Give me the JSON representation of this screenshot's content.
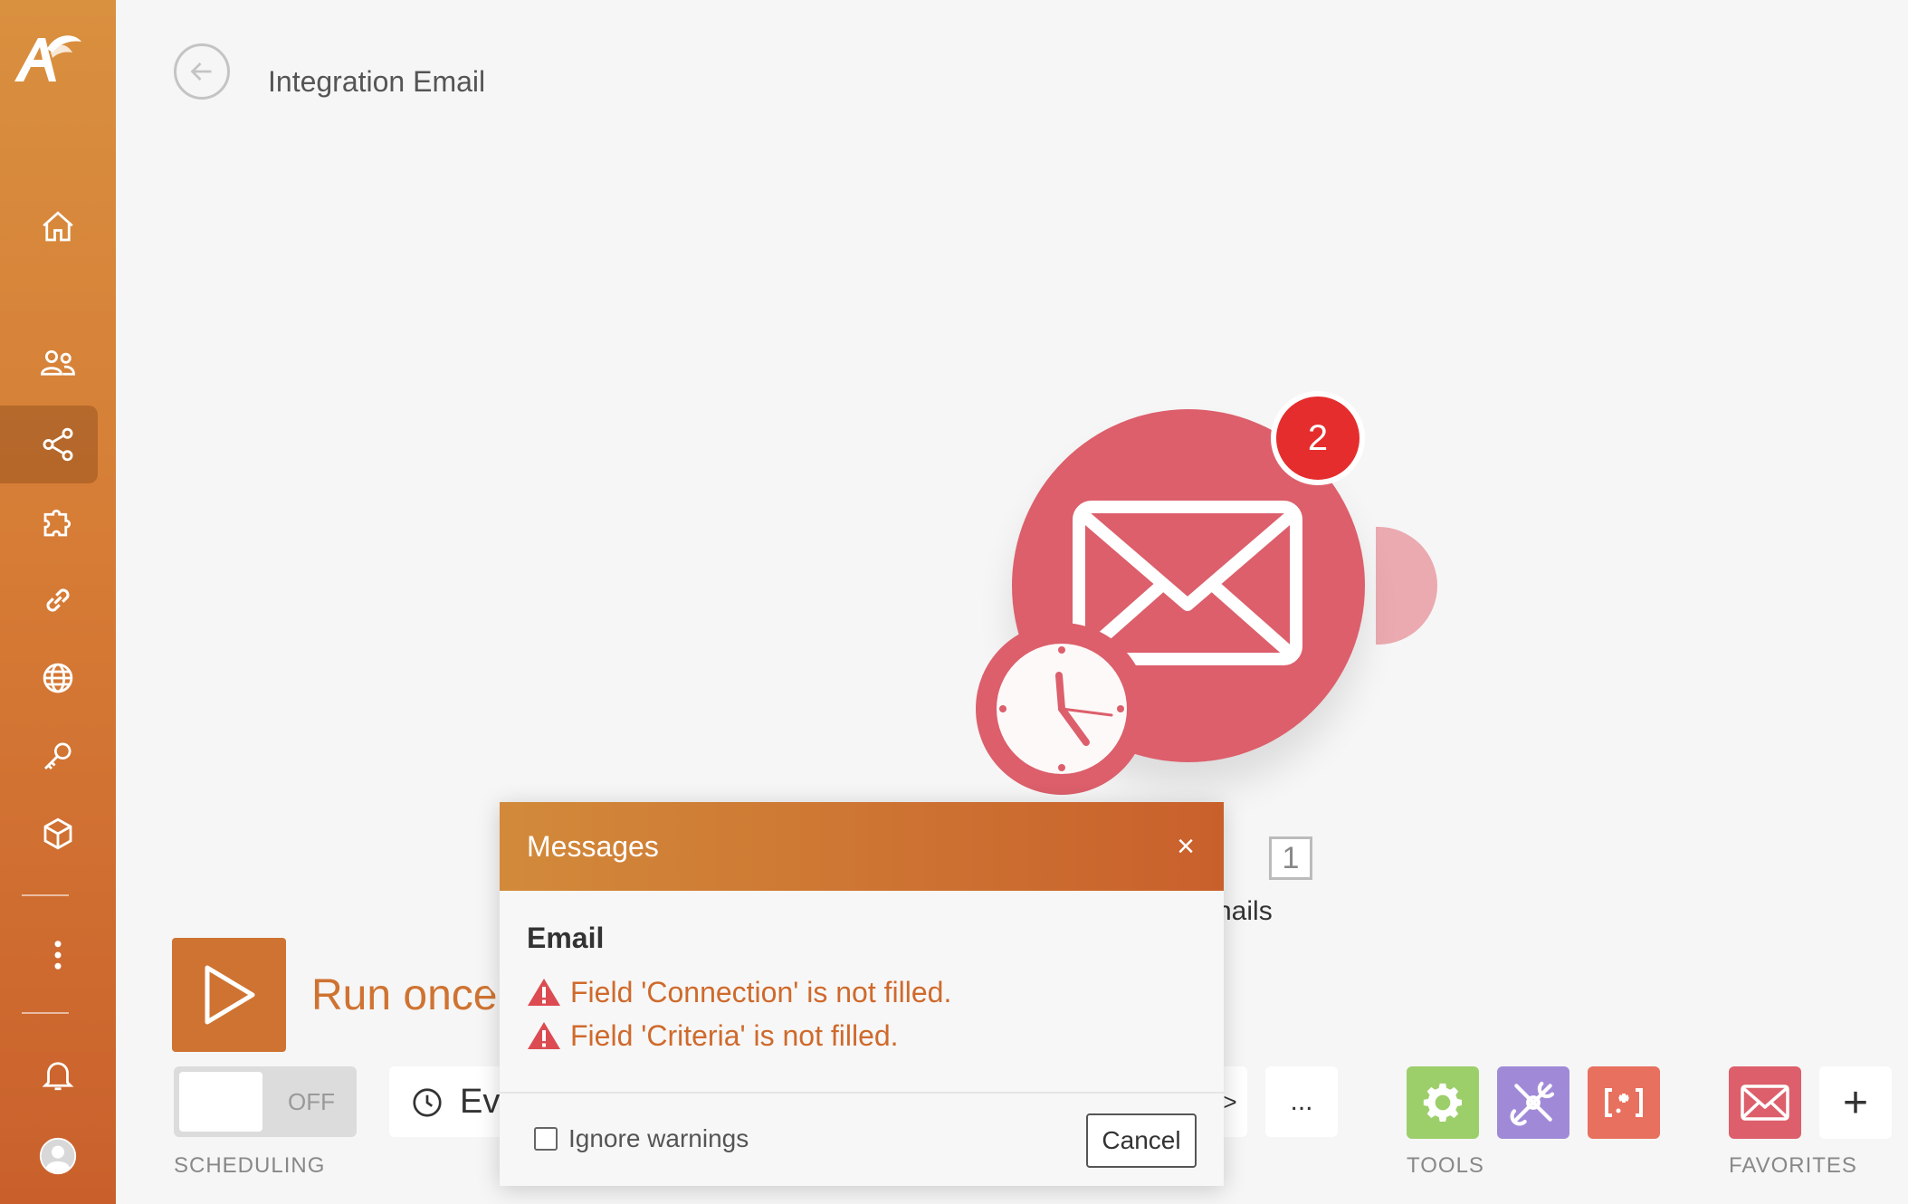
{
  "app": {
    "page_title": "Integration Email"
  },
  "sidebar": {
    "items": [
      {
        "icon": "home-icon"
      },
      {
        "icon": "team-icon"
      },
      {
        "icon": "share-icon",
        "active": true
      },
      {
        "icon": "puzzle-icon"
      },
      {
        "icon": "link-icon"
      },
      {
        "icon": "globe-icon"
      },
      {
        "icon": "key-icon"
      },
      {
        "icon": "box-icon"
      },
      {
        "icon": "more-vertical-icon"
      },
      {
        "icon": "bell-icon"
      },
      {
        "icon": "avatar-icon"
      }
    ]
  },
  "module": {
    "badge_count": "2",
    "title_fragment": "il",
    "number": "1",
    "subtitle_fragment": "nails",
    "color": "#dc5f6b"
  },
  "run": {
    "label": "Run once"
  },
  "scheduling": {
    "toggle_state": "OFF",
    "label": "SCHEDULING",
    "every_fragment": "Ev"
  },
  "toolbar": {
    "more_label": "...",
    "arrow_label": ">",
    "tools_label": "TOOLS",
    "favorites_label": "FAVORITES",
    "add_label": "+"
  },
  "dialog": {
    "title": "Messages",
    "close_label": "×",
    "group_title": "Email",
    "warnings": [
      "Field 'Connection' is not filled.",
      "Field 'Criteria' is not filled."
    ],
    "ignore_label": "Ignore warnings",
    "cancel_label": "Cancel"
  },
  "colors": {
    "accent": "#cf7332",
    "warning_text": "#cf6a2c",
    "badge": "#e52d2d",
    "tool_green": "#9ccf6a",
    "tool_purple": "#a08ad8",
    "tool_orange": "#e8705e",
    "favorite_red": "#dc5f6b"
  }
}
